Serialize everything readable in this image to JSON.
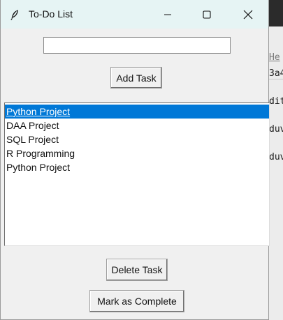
{
  "window": {
    "title": "To-Do List",
    "icon": "feather-icon",
    "controls": {
      "minimize": "minimize-icon",
      "maximize": "maximize-icon",
      "close": "close-icon"
    }
  },
  "task_input": {
    "value": "",
    "placeholder": ""
  },
  "buttons": {
    "add": "Add Task",
    "delete": "Delete Task",
    "complete": "Mark as Complete"
  },
  "tasks": [
    {
      "label": "Python Project",
      "selected": true
    },
    {
      "label": "DAA Project",
      "selected": false
    },
    {
      "label": "SQL Project",
      "selected": false
    },
    {
      "label": "R Programming",
      "selected": false
    },
    {
      "label": "Python Project",
      "selected": false
    }
  ],
  "colors": {
    "selection": "#0078d7",
    "titlebar": "#e6f4f4",
    "window_bg": "#f0f0f0"
  },
  "background_window": {
    "header": "He",
    "lines": [
      "3a4",
      "dit",
      "duv",
      "duv"
    ]
  }
}
